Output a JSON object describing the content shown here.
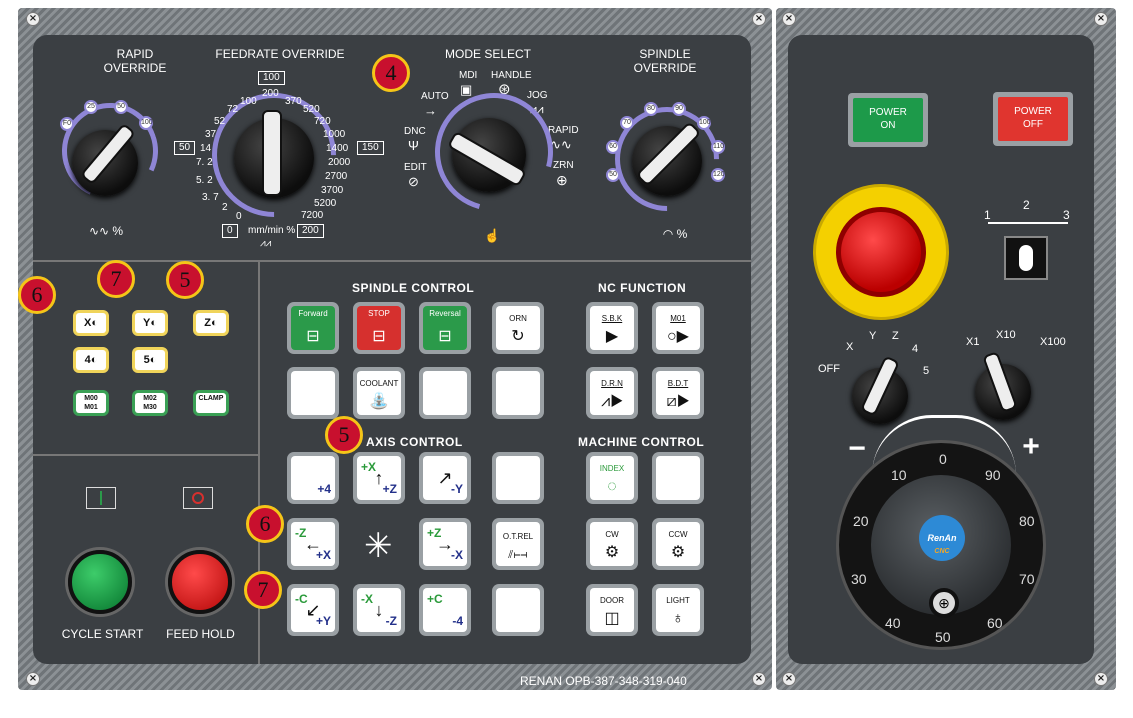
{
  "top": {
    "rapid_override": "RAPID\nOVERRIDE",
    "rapid_ticks": [
      "F0",
      "25",
      "50",
      "100"
    ],
    "feedrate_override": "FEEDRATE OVERRIDE",
    "feedrate_top_box": "100",
    "feedrate_left_box": "50",
    "feedrate_right_box": "150",
    "feedrate_ticks_left": [
      "100",
      "72",
      "52",
      "37",
      "14",
      "7. 2",
      "5. 2",
      "3. 7",
      "2",
      "0"
    ],
    "feedrate_ticks_right": [
      "200",
      "370",
      "520",
      "720",
      "1000",
      "1400",
      "2000",
      "2700",
      "3700",
      "5200",
      "7200"
    ],
    "feedrate_bottom_left_box": "0",
    "feedrate_unit": "mm/min %",
    "feedrate_bottom_right_box": "200",
    "mode_select": "MODE SELECT",
    "modes": [
      "MDI",
      "HANDLE",
      "AUTO",
      "JOG",
      "DNC",
      "RAPID",
      "EDIT",
      "ZRN"
    ],
    "spindle_override": "SPINDLE\nOVERRIDE",
    "spindle_ticks": [
      "50",
      "60",
      "70",
      "80",
      "90",
      "100",
      "110",
      "120"
    ],
    "rapid_unit": "%",
    "spindle_unit": "%"
  },
  "badges": {
    "mode": "4",
    "axis_top": "5",
    "axis_mid": "6",
    "axis_bot": "7",
    "left_6": "6",
    "left_7": "7",
    "left_5": "5"
  },
  "axis_select": {
    "x": "X",
    "y": "Y",
    "z": "Z",
    "four": "4",
    "five": "5",
    "m00": "M00\nM01",
    "m02": "M02\nM30",
    "clamp": "CLAMP"
  },
  "cycle": {
    "start": "CYCLE START",
    "hold": "FEED HOLD"
  },
  "spindle_control": {
    "title": "SPINDLE CONTROL",
    "forward": "Forward",
    "stop": "STOP",
    "reversal": "Reversal",
    "orn": "ORN",
    "coolant": "COOLANT"
  },
  "axis_control": {
    "title": "AXIS CONTROL",
    "k1": "+4",
    "k2a": "+X",
    "k2b": "+Z",
    "k3": "-Y",
    "k5a": "-Z",
    "k5b": "+X",
    "k7a": "+Z",
    "k7b": "-X",
    "otrel": "O.T.REL",
    "k9a": "-C",
    "k9b": "+Y",
    "k10a": "-X",
    "k10b": "-Z",
    "k11a": "+C",
    "k11b": "-4"
  },
  "nc_function": {
    "title": "NC FUNCTION",
    "sbk": "S.B.K",
    "m01": "M01",
    "drn": "D.R.N",
    "bdt": "B.D.T"
  },
  "machine_control": {
    "title": "MACHINE CONTROL",
    "index": "INDEX",
    "cw": "CW",
    "ccw": "CCW",
    "door": "DOOR",
    "light": "LIGHT"
  },
  "right": {
    "power_on": "POWER\nON",
    "power_off": "POWER\nOFF",
    "key_ticks": [
      "1",
      "2",
      "3"
    ],
    "axis_sel_ticks": [
      "OFF",
      "X",
      "Y",
      "Z",
      "4",
      "5"
    ],
    "mult_ticks": [
      "X1",
      "X10",
      "X100"
    ],
    "minus": "−",
    "plus": "+",
    "wheel_numbers": [
      "0",
      "10",
      "20",
      "30",
      "40",
      "50",
      "60",
      "70",
      "80",
      "90"
    ],
    "logo": "RenAn",
    "logo_sub": "CNC"
  },
  "footer": {
    "model": "RENAN OPB-387-348-319-040"
  },
  "colors": {
    "panel": "#3b3f43",
    "badge_red": "#c8102e",
    "badge_ring": "#f5c518",
    "scale_purple": "#8f86d6",
    "green": "#2b9a4a",
    "red": "#d6302e"
  }
}
